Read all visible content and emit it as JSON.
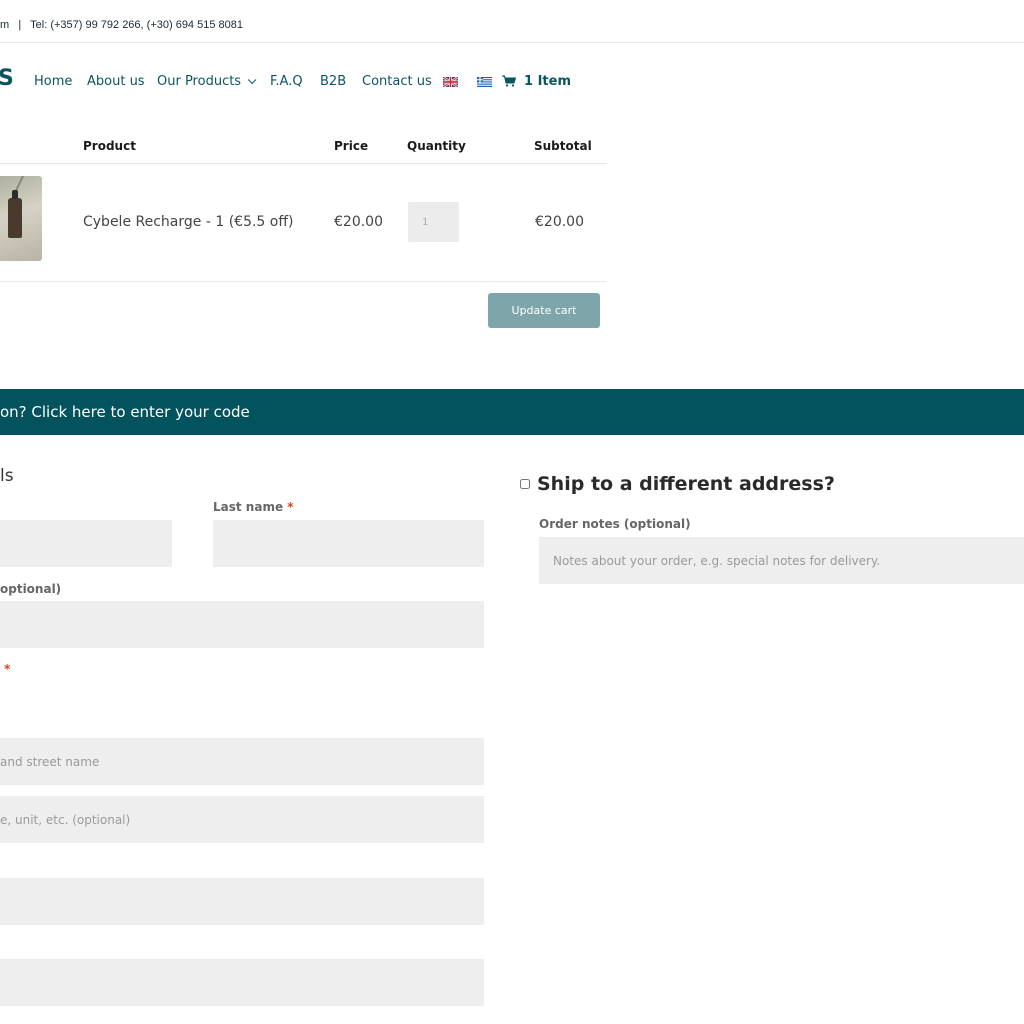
{
  "topbar": {
    "text": "m   |   Tel: (+357) 99 792 266, (+30) 694 515 8081"
  },
  "nav": {
    "logo_fragment": "S",
    "items": [
      "Home",
      "About us",
      "Our Products",
      "F.A.Q",
      "B2B",
      "Contact us"
    ],
    "cart_label": "1 Item"
  },
  "cart": {
    "headers": {
      "product": "Product",
      "price": "Price",
      "quantity": "Quantity",
      "subtotal": "Subtotal"
    },
    "rows": [
      {
        "product": "Cybele Recharge - 1 (€5.5 off)",
        "price": "€20.00",
        "quantity": "1",
        "subtotal": "€20.00"
      }
    ],
    "update_label": "Update cart"
  },
  "coupon": {
    "text": "on? Click here to enter your code"
  },
  "billing": {
    "title_fragment": "ls",
    "last_name_label": "Last name",
    "required_mark": "*",
    "company_label_fragment": "optional)",
    "street_placeholder": "and street name",
    "apartment_placeholder": "e, unit, etc. (optional)"
  },
  "shipping": {
    "title": "Ship to a different address?",
    "notes_label": "Order notes (optional)",
    "notes_placeholder": "Notes about your order, e.g. special notes for delivery."
  },
  "colors": {
    "brand": "#0b5561",
    "coupon_bg": "#03535e",
    "button": "#7ea6aa",
    "field_bg": "#eeeeee",
    "required": "#e2401c"
  }
}
